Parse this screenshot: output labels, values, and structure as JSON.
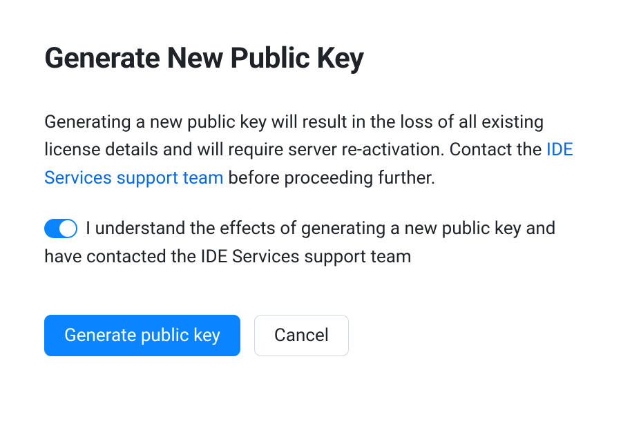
{
  "dialog": {
    "title": "Generate New Public Key",
    "description_before_link": "Generating a new public key will result in the loss of all existing license details and will require server re-activation. Contact the ",
    "link_text": "IDE Services support team",
    "description_after_link": " before proceeding further.",
    "toggle": {
      "enabled": true,
      "label": "I understand the effects of generating a new public key and have contacted the IDE Services support team"
    },
    "buttons": {
      "primary": "Generate public key",
      "secondary": "Cancel"
    },
    "colors": {
      "accent": "#0b84ff",
      "link": "#0969da",
      "text": "#1f2328",
      "border": "#d0d7de"
    }
  }
}
